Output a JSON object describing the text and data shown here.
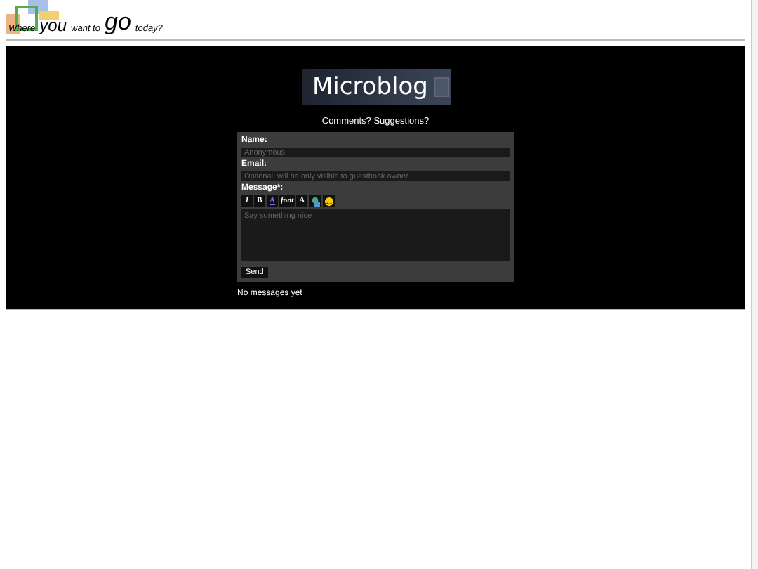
{
  "header": {
    "words": [
      {
        "text": "Where",
        "kind": "small"
      },
      {
        "text": "you",
        "kind": "big"
      },
      {
        "text": "want to",
        "kind": "small"
      },
      {
        "text": "go",
        "kind": "huge"
      },
      {
        "text": "today?",
        "kind": "small"
      }
    ]
  },
  "blog": {
    "title": "Microblog",
    "subtitle": "Comments? Suggestions?",
    "form": {
      "name_label": "Name:",
      "name_placeholder": "Anonymous",
      "email_label": "Email:",
      "email_placeholder": "Optional, will be only visible to guestbook owner",
      "message_label": "Message*:",
      "toolbar": [
        {
          "kind": "italic",
          "label": "I"
        },
        {
          "kind": "bold",
          "label": "B"
        },
        {
          "kind": "color",
          "label": "A"
        },
        {
          "kind": "font",
          "label": "font"
        },
        {
          "kind": "size",
          "label": "A"
        },
        {
          "kind": "image"
        },
        {
          "kind": "smiley"
        }
      ],
      "message_placeholder": "Say something nice",
      "send": "Send"
    },
    "empty": "No messages yet"
  }
}
